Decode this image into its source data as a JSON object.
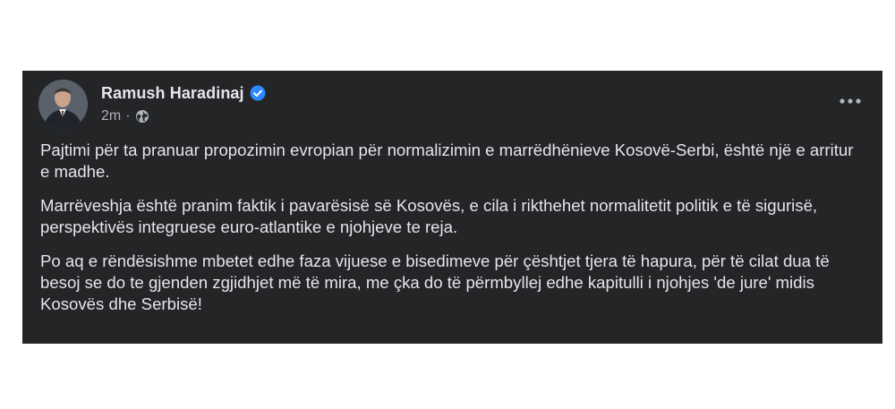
{
  "post": {
    "author": "Ramush Haradinaj",
    "timestamp": "2m",
    "separator": "·",
    "audience_icon": "globe-icon",
    "verified_icon": "verified-badge-icon",
    "more_icon": "more-options-icon",
    "paragraphs": [
      "Pajtimi për ta pranuar propozimin evropian për normalizimin e marrëdhënieve Kosovë-Serbi, është një e arritur e madhe.",
      "Marrëveshja është pranim faktik i pavarësisë së Kosovës, e cila i rikthehet normalitetit politik e të sigurisë, perspektivës integruese euro-atlantike e njohjeve te reja.",
      "Po aq e rëndësishme mbetet edhe faza vijuese e bisedimeve për çështjet tjera të hapura, për të cilat dua të besoj se do te gjenden zgjidhjet më të mira, me çka do të përmbyllej edhe kapitulli i njohjes 'de jure' midis Kosovës dhe Serbisë!"
    ]
  },
  "colors": {
    "card_background": "#242526",
    "primary_text": "#e4e6eb",
    "secondary_text": "#b0b3b8",
    "verified_blue": "#2d88ff",
    "page_background": "#ffffff"
  }
}
